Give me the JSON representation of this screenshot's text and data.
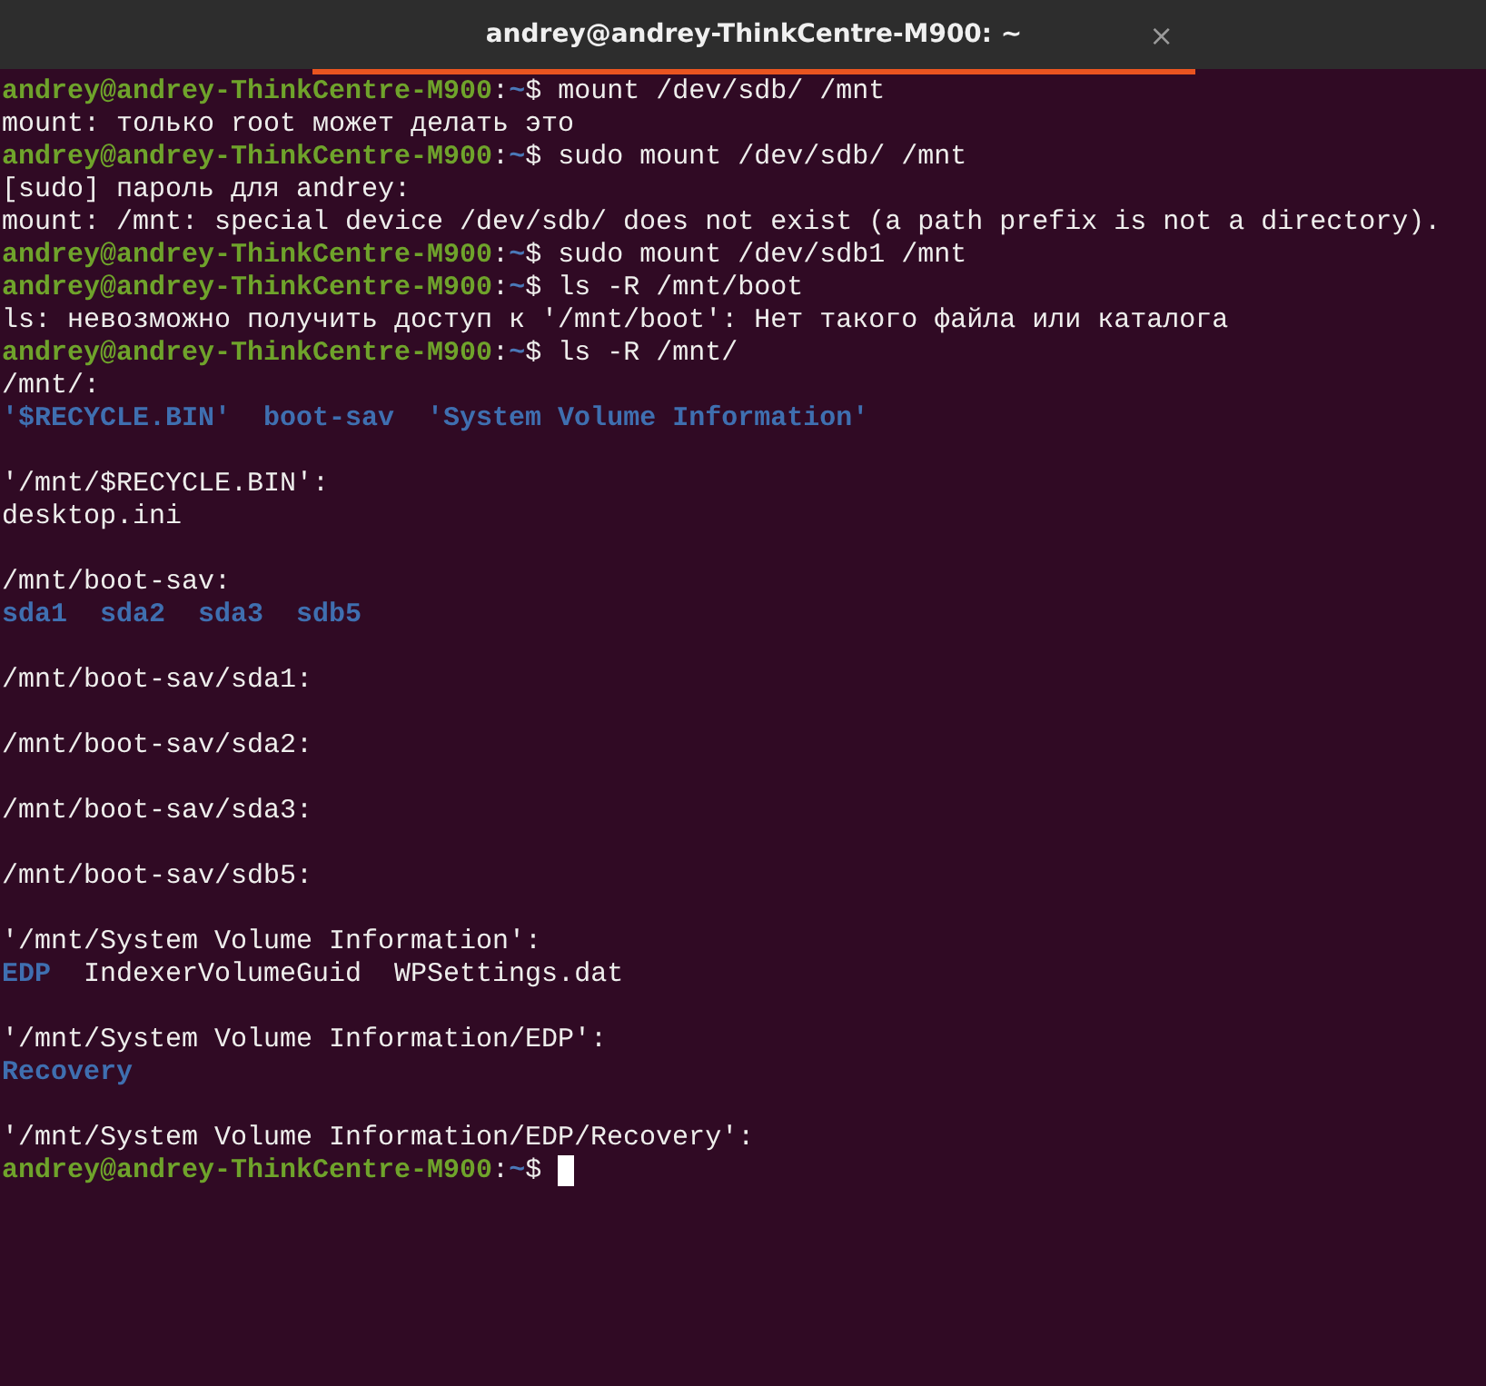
{
  "window": {
    "title": "andrey@andrey-ThinkCentre-M900: ~",
    "tab_selected": true,
    "close": "×"
  },
  "lines": [
    {
      "kind": "prompt",
      "user_host": "andrey@andrey-ThinkCentre-M900",
      "separator": ":",
      "path": "~",
      "symbol": "$",
      "command": "mount /dev/sdb/ /mnt"
    },
    {
      "kind": "output",
      "text": "mount: только root может делать это"
    },
    {
      "kind": "prompt",
      "user_host": "andrey@andrey-ThinkCentre-M900",
      "separator": ":",
      "path": "~",
      "symbol": "$",
      "command": "sudo mount /dev/sdb/ /mnt"
    },
    {
      "kind": "output",
      "text": "[sudo] пароль для andrey:"
    },
    {
      "kind": "output",
      "text": "mount: /mnt: special device /dev/sdb/ does not exist (a path prefix is not a directory)."
    },
    {
      "kind": "prompt",
      "user_host": "andrey@andrey-ThinkCentre-M900",
      "separator": ":",
      "path": "~",
      "symbol": "$",
      "command": "sudo mount /dev/sdb1 /mnt"
    },
    {
      "kind": "prompt",
      "user_host": "andrey@andrey-ThinkCentre-M900",
      "separator": ":",
      "path": "~",
      "symbol": "$",
      "command": "ls -R /mnt/boot"
    },
    {
      "kind": "output",
      "text": "ls: невозможно получить доступ к '/mnt/boot': Нет такого файла или каталога"
    },
    {
      "kind": "prompt",
      "user_host": "andrey@andrey-ThinkCentre-M900",
      "separator": ":",
      "path": "~",
      "symbol": "$",
      "command": "ls -R /mnt/"
    },
    {
      "kind": "output",
      "text": "/mnt/:"
    },
    {
      "kind": "listing",
      "items": [
        {
          "name": "'$RECYCLE.BIN'",
          "kind": "dir"
        },
        {
          "name": "boot-sav",
          "kind": "dir"
        },
        {
          "name": "'System Volume Information'",
          "kind": "dir"
        }
      ]
    },
    {
      "kind": "blank"
    },
    {
      "kind": "output",
      "text": "'/mnt/$RECYCLE.BIN':"
    },
    {
      "kind": "output",
      "text": "desktop.ini"
    },
    {
      "kind": "blank"
    },
    {
      "kind": "output",
      "text": "/mnt/boot-sav:"
    },
    {
      "kind": "listing",
      "items": [
        {
          "name": "sda1",
          "kind": "dir"
        },
        {
          "name": "sda2",
          "kind": "dir"
        },
        {
          "name": "sda3",
          "kind": "dir"
        },
        {
          "name": "sdb5",
          "kind": "dir"
        }
      ]
    },
    {
      "kind": "blank"
    },
    {
      "kind": "output",
      "text": "/mnt/boot-sav/sda1:"
    },
    {
      "kind": "blank"
    },
    {
      "kind": "output",
      "text": "/mnt/boot-sav/sda2:"
    },
    {
      "kind": "blank"
    },
    {
      "kind": "output",
      "text": "/mnt/boot-sav/sda3:"
    },
    {
      "kind": "blank"
    },
    {
      "kind": "output",
      "text": "/mnt/boot-sav/sdb5:"
    },
    {
      "kind": "blank"
    },
    {
      "kind": "output",
      "text": "'/mnt/System Volume Information':"
    },
    {
      "kind": "listing",
      "items": [
        {
          "name": "EDP",
          "kind": "dir"
        },
        {
          "name": "IndexerVolumeGuid",
          "kind": "file"
        },
        {
          "name": "WPSettings.dat",
          "kind": "file"
        }
      ]
    },
    {
      "kind": "blank"
    },
    {
      "kind": "output",
      "text": "'/mnt/System Volume Information/EDP':"
    },
    {
      "kind": "listing",
      "items": [
        {
          "name": "Recovery",
          "kind": "dir"
        }
      ]
    },
    {
      "kind": "blank"
    },
    {
      "kind": "output",
      "text": "'/mnt/System Volume Information/EDP/Recovery':"
    },
    {
      "kind": "prompt",
      "user_host": "andrey@andrey-ThinkCentre-M900",
      "separator": ":",
      "path": "~",
      "symbol": "$",
      "cursor": true
    }
  ]
}
